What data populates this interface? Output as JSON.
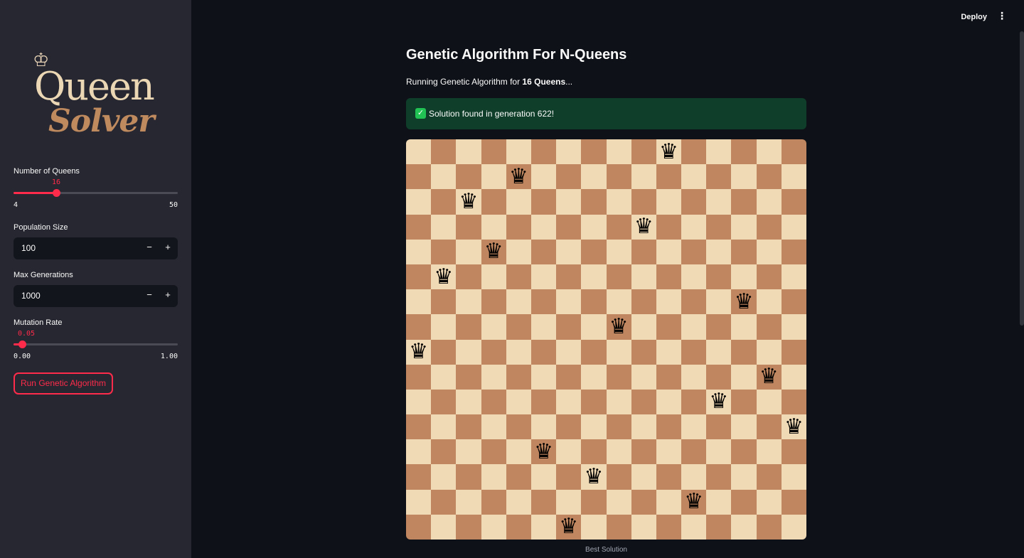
{
  "header": {
    "deploy_label": "Deploy",
    "menu_icon": "kebab-menu-icon"
  },
  "sidebar": {
    "logo": {
      "crown_icon": "crown-icon",
      "line1": "Queen",
      "line2": "Solver"
    },
    "num_queens": {
      "label": "Number of Queens",
      "value": "16",
      "min": "4",
      "max": "50",
      "fraction": 0.26
    },
    "population": {
      "label": "Population Size",
      "value": "100",
      "minus": "−",
      "plus": "+"
    },
    "max_generations": {
      "label": "Max Generations",
      "value": "1000",
      "minus": "−",
      "plus": "+"
    },
    "mutation_rate": {
      "label": "Mutation Rate",
      "value": "0.05",
      "min": "0.00",
      "max": "1.00",
      "fraction": 0.05
    },
    "run_button": "Run Genetic Algorithm"
  },
  "main": {
    "title": "Genetic Algorithm For N-Queens",
    "subtitle_prefix": "Running Genetic Algorithm for ",
    "subtitle_bold": "16 Queens",
    "subtitle_suffix": "...",
    "success_icon": "check-mark-icon",
    "success_message": "Solution found in generation 622!",
    "caption": "Best Solution"
  },
  "board": {
    "size": 16,
    "queen_glyph": "♛",
    "queen_columns": [
      10,
      4,
      2,
      9,
      3,
      1,
      13,
      8,
      0,
      14,
      12,
      15,
      5,
      7,
      11,
      6
    ],
    "colors": {
      "light": "#f0d9b5",
      "dark": "#bf865f"
    }
  },
  "colors": {
    "accent": "#ff2b4b",
    "success_bg": "#0f3f2a",
    "success_icon": "#21c354"
  }
}
